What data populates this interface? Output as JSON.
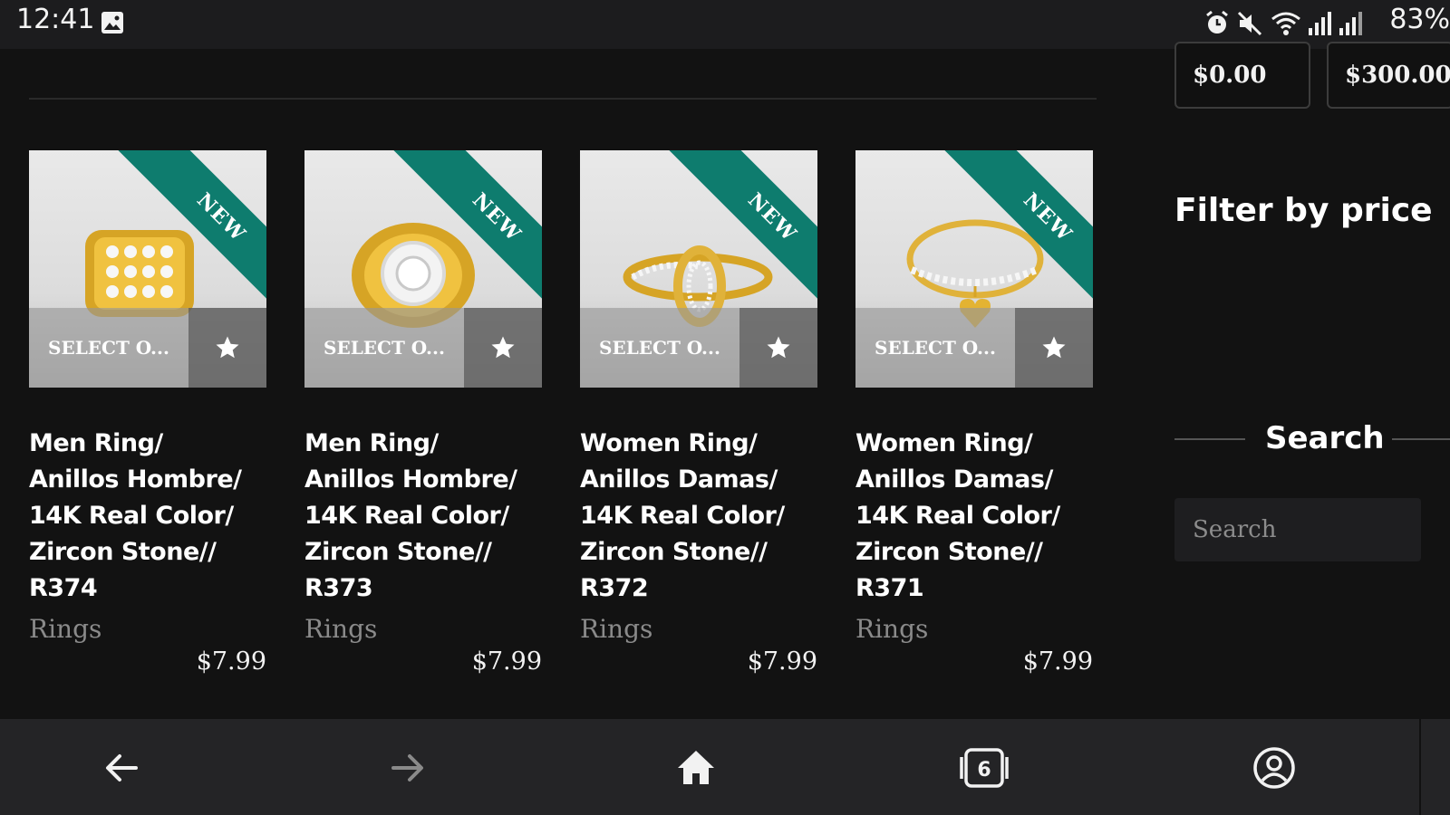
{
  "status_bar": {
    "time": "12:41",
    "battery": "83%",
    "icons": [
      "image-icon",
      "alarm-icon",
      "mute-icon",
      "wifi-icon",
      "signal-icon",
      "signal-icon-2"
    ]
  },
  "price_filter": {
    "min_value": "$0.00",
    "max_value": "$300.00",
    "title": "Filter by price"
  },
  "products": [
    {
      "badge": "NEW",
      "select_label": "SELECT O...",
      "title": "Men Ring/\nAnillos Hombre/\n14K Real Color/\nZircon Stone//\nR374",
      "category": "Rings",
      "price": "$7.99"
    },
    {
      "badge": "NEW",
      "select_label": "SELECT O...",
      "title": "Men Ring/\nAnillos Hombre/\n14K Real Color/\nZircon Stone//\nR373",
      "category": "Rings",
      "price": "$7.99"
    },
    {
      "badge": "NEW",
      "select_label": "SELECT O...",
      "title": "Women Ring/\nAnillos Damas/\n14K Real Color/\nZircon Stone//\nR372",
      "category": "Rings",
      "price": "$7.99"
    },
    {
      "badge": "NEW",
      "select_label": "SELECT O...",
      "title": "Women Ring/\nAnillos Damas/\n14K Real Color/\nZircon Stone//\nR371",
      "category": "Rings",
      "price": "$7.99"
    }
  ],
  "search": {
    "heading": "Search",
    "placeholder": "Search"
  },
  "bottom_nav": {
    "tab_count": "6",
    "buttons": [
      "back-arrow-icon",
      "forward-arrow-icon",
      "home-icon",
      "tabs-icon",
      "account-icon"
    ]
  },
  "colors": {
    "ribbon": "#0e7c6e",
    "background": "#121212",
    "nav_background": "#242426"
  }
}
